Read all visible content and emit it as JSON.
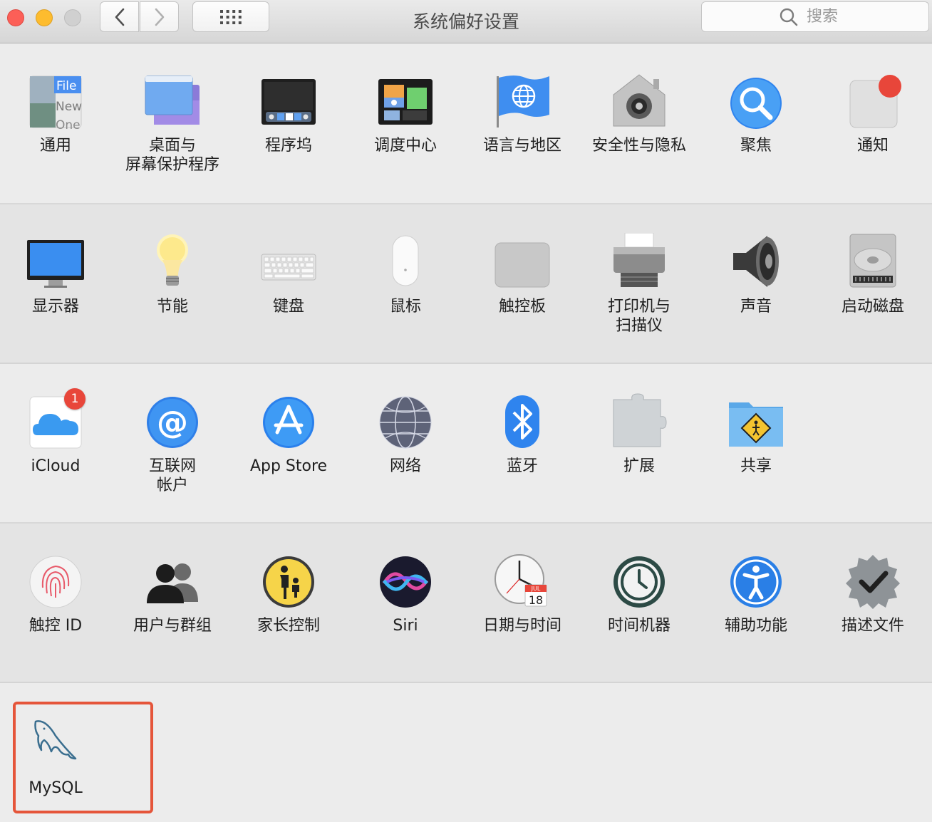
{
  "window": {
    "title": "系统偏好设置",
    "search_placeholder": "搜索"
  },
  "colors": {
    "highlight_border": "#e5553a",
    "badge": "#e8463a",
    "accent_blue": "#2f7ff0"
  },
  "rows": [
    [
      {
        "label": "通用",
        "icon": "general-icon"
      },
      {
        "label": "桌面与\n屏幕保护程序",
        "icon": "desktop-screensaver-icon"
      },
      {
        "label": "程序坞",
        "icon": "dock-icon"
      },
      {
        "label": "调度中心",
        "icon": "mission-control-icon"
      },
      {
        "label": "语言与地区",
        "icon": "language-region-icon"
      },
      {
        "label": "安全性与隐私",
        "icon": "security-privacy-icon"
      },
      {
        "label": "聚焦",
        "icon": "spotlight-icon"
      },
      {
        "label": "通知",
        "icon": "notifications-icon"
      }
    ],
    [
      {
        "label": "显示器",
        "icon": "displays-icon"
      },
      {
        "label": "节能",
        "icon": "energy-saver-icon"
      },
      {
        "label": "键盘",
        "icon": "keyboard-icon"
      },
      {
        "label": "鼠标",
        "icon": "mouse-icon"
      },
      {
        "label": "触控板",
        "icon": "trackpad-icon"
      },
      {
        "label": "打印机与\n扫描仪",
        "icon": "printers-scanners-icon"
      },
      {
        "label": "声音",
        "icon": "sound-icon"
      },
      {
        "label": "启动磁盘",
        "icon": "startup-disk-icon"
      }
    ],
    [
      {
        "label": "iCloud",
        "icon": "icloud-icon",
        "badge": "1"
      },
      {
        "label": "互联网\n帐户",
        "icon": "internet-accounts-icon"
      },
      {
        "label": "App Store",
        "icon": "app-store-icon"
      },
      {
        "label": "网络",
        "icon": "network-icon"
      },
      {
        "label": "蓝牙",
        "icon": "bluetooth-icon"
      },
      {
        "label": "扩展",
        "icon": "extensions-icon"
      },
      {
        "label": "共享",
        "icon": "sharing-icon"
      }
    ],
    [
      {
        "label": "触控 ID",
        "icon": "touch-id-icon"
      },
      {
        "label": "用户与群组",
        "icon": "users-groups-icon"
      },
      {
        "label": "家长控制",
        "icon": "parental-controls-icon"
      },
      {
        "label": "Siri",
        "icon": "siri-icon"
      },
      {
        "label": "日期与时间",
        "icon": "date-time-icon",
        "calendar_month": "JUL",
        "calendar_day": "18"
      },
      {
        "label": "时间机器",
        "icon": "time-machine-icon"
      },
      {
        "label": "辅助功能",
        "icon": "accessibility-icon"
      },
      {
        "label": "描述文件",
        "icon": "profiles-icon"
      }
    ],
    [
      {
        "label": "MySQL",
        "icon": "mysql-dolphin-icon",
        "highlighted": true
      }
    ]
  ],
  "general_icon_text": [
    "File",
    "New",
    "One"
  ]
}
